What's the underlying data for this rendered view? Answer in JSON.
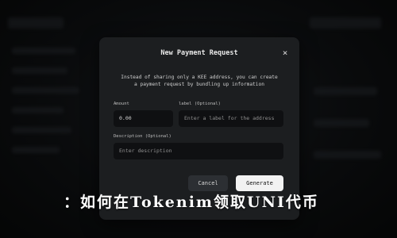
{
  "modal": {
    "title": "New Payment Request",
    "close_glyph": "×",
    "description_line1": "Instead of sharing only a KEE address, you can create",
    "description_line2": "a payment request by bundling up information",
    "amount_label": "Amount",
    "amount_value": "0.00",
    "label_label": "label (Optional)",
    "label_placeholder": "Enter a label for the address",
    "description_label": "Description (Optional)",
    "description_placeholder": "Enter description",
    "cancel_label": "Cancel",
    "generate_label": "Generate"
  },
  "caption": "：如何在Tokenim领取UNI代币",
  "icons": {
    "close": "close-icon"
  },
  "colors": {
    "modal_bg": "#1c1e20",
    "input_bg": "#0f1012",
    "primary_button": "#f2f2f2",
    "secondary_button": "#2c2f33"
  }
}
